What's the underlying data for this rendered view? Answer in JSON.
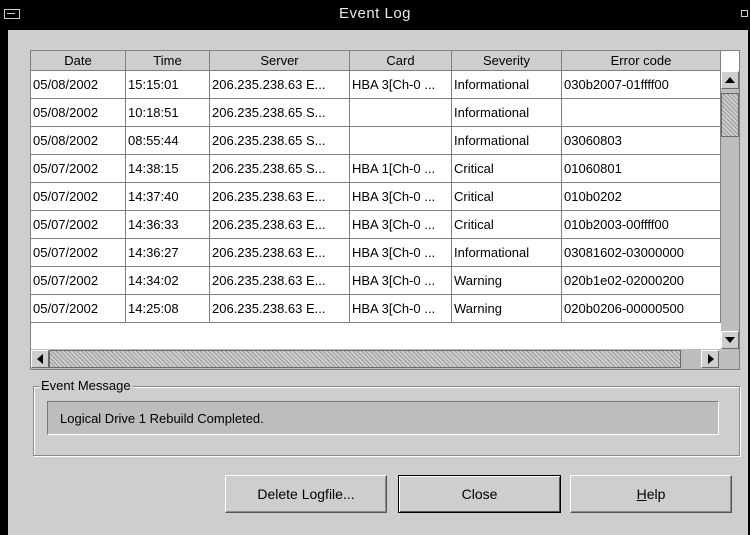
{
  "window": {
    "title": "Event Log"
  },
  "table": {
    "columns": [
      "Date",
      "Time",
      "Server",
      "Card",
      "Severity",
      "Error code"
    ],
    "rows": [
      [
        "05/08/2002",
        "15:15:01",
        "206.235.238.63 E...",
        "HBA 3[Ch-0 ...",
        "Informational",
        "030b2007-01ffff00"
      ],
      [
        "05/08/2002",
        "10:18:51",
        "206.235.238.65 S...",
        "",
        "Informational",
        ""
      ],
      [
        "05/08/2002",
        "08:55:44",
        "206.235.238.65 S...",
        "",
        "Informational",
        "03060803"
      ],
      [
        "05/07/2002",
        "14:38:15",
        "206.235.238.65 S...",
        "HBA 1[Ch-0 ...",
        "Critical",
        "01060801"
      ],
      [
        "05/07/2002",
        "14:37:40",
        "206.235.238.63 E...",
        "HBA 3[Ch-0 ...",
        "Critical",
        "010b0202"
      ],
      [
        "05/07/2002",
        "14:36:33",
        "206.235.238.63 E...",
        "HBA 3[Ch-0 ...",
        "Critical",
        "010b2003-00ffff00"
      ],
      [
        "05/07/2002",
        "14:36:27",
        "206.235.238.63 E...",
        "HBA 3[Ch-0 ...",
        "Informational",
        "03081602-03000000"
      ],
      [
        "05/07/2002",
        "14:34:02",
        "206.235.238.63 E...",
        "HBA 3[Ch-0 ...",
        "Warning",
        "020b1e02-02000200"
      ],
      [
        "05/07/2002",
        "14:25:08",
        "206.235.238.63 E...",
        "HBA 3[Ch-0 ...",
        "Warning",
        "020b0206-00000500"
      ]
    ]
  },
  "event_message": {
    "label": "Event Message",
    "text": "Logical Drive 1 Rebuild Completed."
  },
  "buttons": {
    "delete": "Delete Logfile...",
    "close": "Close",
    "help_prefix": "H",
    "help_rest": "elp"
  },
  "colors": {
    "title_bar": "#000000",
    "panel": "#cecece",
    "field": "#bdbdbd"
  }
}
